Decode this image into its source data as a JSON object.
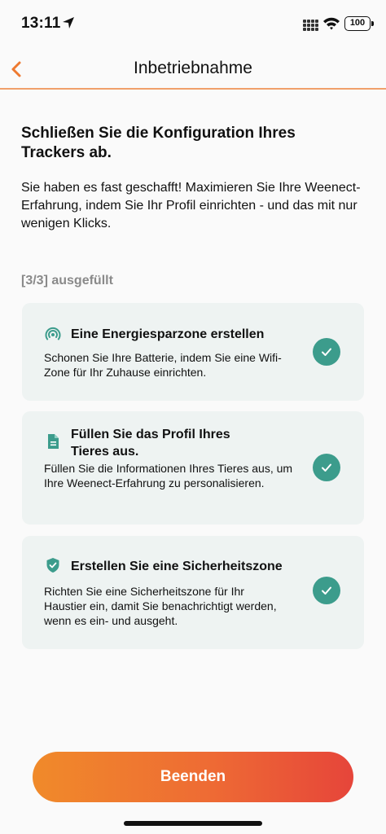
{
  "status_bar": {
    "time": "13:11",
    "battery": "100"
  },
  "nav": {
    "title": "Inbetriebnahme"
  },
  "main": {
    "heading": "Schließen Sie die Konfiguration Ihres Trackers ab.",
    "intro": "Sie haben es fast geschafft! Maximieren Sie Ihre Weenect-Erfahrung, indem Sie Ihr Profil einrichten - und das mit nur wenigen Klicks.",
    "progress": "[3/3] ausgefüllt",
    "cards": [
      {
        "icon": "wifi-zone-icon",
        "title": "Eine Energiesparzone erstellen",
        "description": "Schonen Sie Ihre Batterie, indem Sie eine Wifi-Zone für Ihr Zuhause einrichten.",
        "completed": true
      },
      {
        "icon": "document-icon",
        "title": "Füllen Sie das Profil Ihres Tieres aus.",
        "description": "Füllen Sie die Informationen Ihres Tieres aus, um Ihre Weenect-Erfahrung zu personalisieren.",
        "completed": true
      },
      {
        "icon": "shield-check-icon",
        "title": "Erstellen Sie eine Sicherheitszone",
        "description": "Richten Sie eine Sicherheitszone für Ihr Haustier ein, damit Sie benachrichtigt werden, wenn es ein- und ausgeht.",
        "completed": true
      }
    ],
    "finish_label": "Beenden"
  },
  "colors": {
    "accent": "#ee6b34",
    "teal": "#3c9c8c",
    "card_bg": "#eef3f2"
  }
}
